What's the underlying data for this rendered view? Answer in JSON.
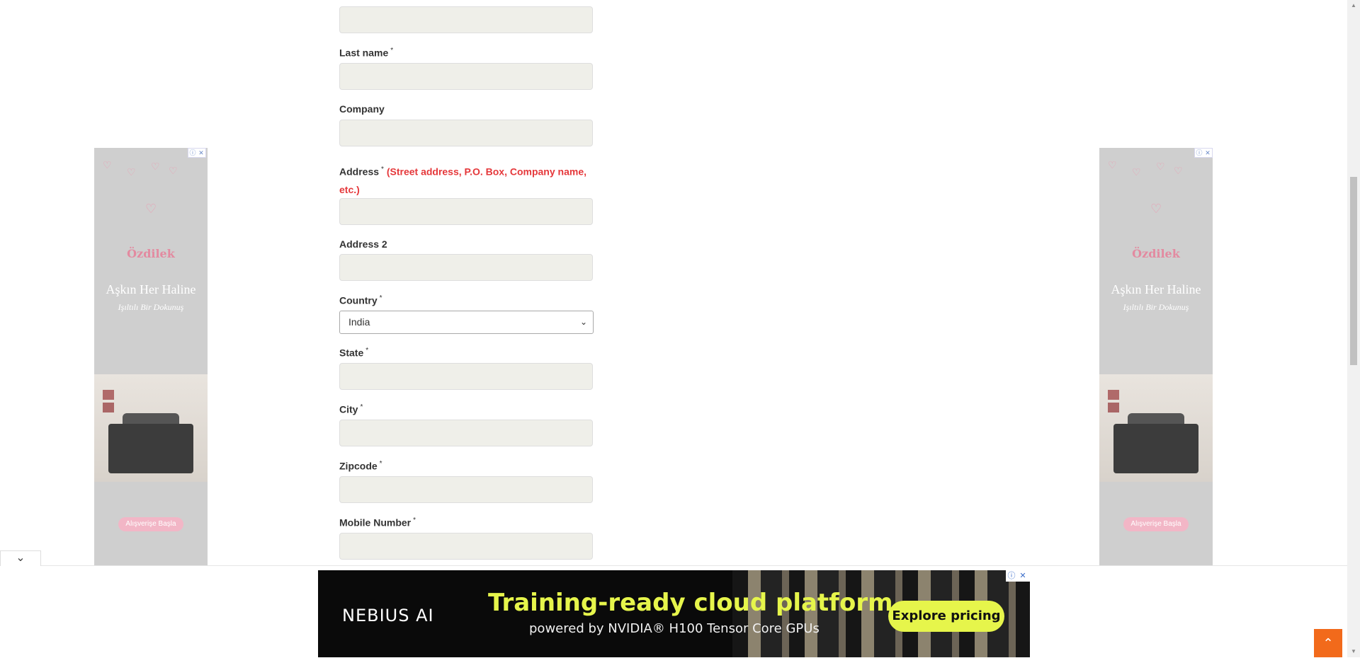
{
  "form": {
    "last_name_label": "Last name",
    "company_label": "Company",
    "address_label": "Address",
    "address_hint": "(Street address, P.O. Box, Company name, etc.)",
    "address2_label": "Address 2",
    "country_label": "Country",
    "country_value": "India",
    "state_label": "State",
    "city_label": "City",
    "zipcode_label": "Zipcode",
    "mobile_label": "Mobile Number",
    "required_mark": "*"
  },
  "side_ad": {
    "brand": "Özdilek",
    "headline": "Aşkın Her Haline",
    "subline": "Işıltılı Bir Dokunuş",
    "cta": "Alışverişe Başla",
    "heart_icon": "heart-icon",
    "info_icon": "info-icon",
    "close_icon": "close-icon"
  },
  "banner_ad": {
    "logo": "NEBIUS AI",
    "headline": "Training-ready cloud platform",
    "subline": "powered by NVIDIA® H100 Tensor Core GPUs",
    "cta": "Explore pricing",
    "accent_color": "#e6f54b"
  },
  "ui": {
    "collapse_icon": "chevron-down-icon",
    "back_to_top_icon": "chevron-up-icon",
    "back_to_top_color": "#f26a1b"
  }
}
